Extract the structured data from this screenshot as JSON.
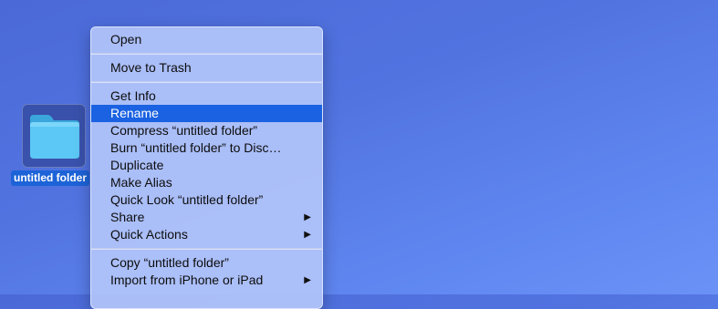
{
  "desktop": {
    "folder": {
      "label": "untitled folder",
      "icon": "folder-icon",
      "color": "#5cc8f5"
    }
  },
  "context_menu": {
    "groups": [
      [
        {
          "label": "Open"
        }
      ],
      [
        {
          "label": "Move to Trash"
        }
      ],
      [
        {
          "label": "Get Info"
        },
        {
          "label": "Rename",
          "selected": true
        },
        {
          "label": "Compress “untitled folder”"
        },
        {
          "label": "Burn “untitled folder” to Disc…"
        },
        {
          "label": "Duplicate"
        },
        {
          "label": "Make Alias"
        },
        {
          "label": "Quick Look “untitled folder”"
        },
        {
          "label": "Share",
          "submenu": true
        },
        {
          "label": "Quick Actions",
          "submenu": true
        }
      ],
      [
        {
          "label": "Copy “untitled folder”"
        },
        {
          "label": "Import from iPhone or iPad",
          "submenu": true
        }
      ]
    ],
    "submenu_icon": "chevron-right-icon",
    "highlight_color": "#1a62e1"
  }
}
